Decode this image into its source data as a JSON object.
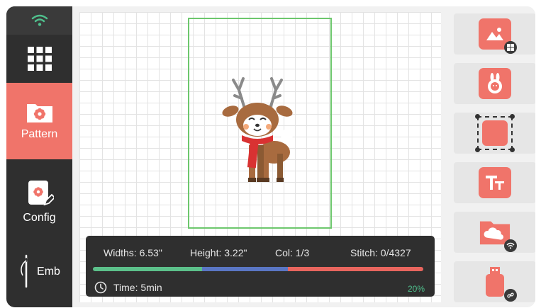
{
  "sidebar": {
    "items": [
      {
        "label": "Pattern"
      },
      {
        "label": "Config"
      },
      {
        "label": "Emb"
      }
    ]
  },
  "info": {
    "width_label": "Widths: 6.53\"",
    "height_label": "Height: 3.22\"",
    "col_label": "Col: 1/3",
    "stitch_label": "Stitch: 0/4327",
    "time_label": "Time: 5min",
    "percent": "20%",
    "progress_segments": [
      {
        "fraction": 0.33,
        "color": "#5cc08a"
      },
      {
        "fraction": 0.26,
        "color": "#5a76c4"
      },
      {
        "fraction": 0.41,
        "color": "#e8655e"
      }
    ]
  },
  "colors": {
    "accent": "#f0746a",
    "sidebar_bg": "#2f2f2f",
    "hoop_border": "#6dc76d",
    "wifi": "#4fc08d",
    "percent_text": "#4fc08d"
  },
  "tools": [
    {
      "icon": "image-icon",
      "badge": "windows-icon"
    },
    {
      "icon": "bunny-icon",
      "badge": ""
    },
    {
      "icon": "select-box-icon",
      "badge": ""
    },
    {
      "icon": "text-icon",
      "badge": ""
    },
    {
      "icon": "cloud-folder-icon",
      "badge": "wifi-icon"
    },
    {
      "icon": "usb-icon",
      "badge": "link-icon"
    }
  ]
}
